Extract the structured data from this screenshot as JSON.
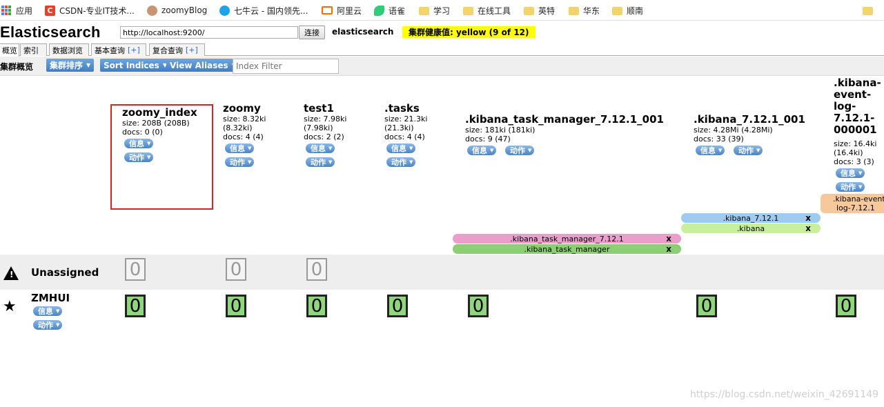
{
  "bookmarks": [
    "应用",
    "CSDN-专业IT技术...",
    "zoomyBlog",
    "七牛云 - 国内领先...",
    "阿里云",
    "语雀",
    "学习",
    "在线工具",
    "英特",
    "华东",
    "顺南"
  ],
  "header": {
    "title": "Elasticsearch",
    "url": "http://localhost:9200/",
    "connect_label": "连接",
    "cluster_name": "elasticsearch",
    "health": "集群健康值: yellow (9 of 12)"
  },
  "tabs": [
    {
      "label": "概览",
      "plus": ""
    },
    {
      "label": "索引",
      "plus": ""
    },
    {
      "label": "数据浏览",
      "plus": ""
    },
    {
      "label": "基本查询",
      "plus": "[+]"
    },
    {
      "label": "复合查询",
      "plus": "[+]"
    }
  ],
  "toolbar": {
    "title": "集群概览",
    "sort_cluster": "集群排序",
    "sort_indices": "Sort Indices",
    "view_aliases": "View Aliases",
    "filter_placeholder": "Index Filter"
  },
  "buttons": {
    "info": "信息",
    "action": "动作"
  },
  "indices": [
    {
      "name": "zoomy_index",
      "stats": [
        "size: 208B (208B)",
        "docs: 0 (0)"
      ]
    },
    {
      "name": "zoomy",
      "stats": [
        "size: 8.32ki",
        "(8.32ki)",
        "docs: 4 (4)"
      ]
    },
    {
      "name": "test1",
      "stats": [
        "size: 7.98ki",
        "(7.98ki)",
        "docs: 2 (2)"
      ]
    },
    {
      "name": ".tasks",
      "stats": [
        "size: 21.3ki",
        "(21.3ki)",
        "docs: 4 (4)"
      ]
    },
    {
      "name": ".kibana_task_manager_7.12.1_001",
      "stats": [
        "size: 181ki (181ki)",
        "docs: 9 (47)"
      ]
    },
    {
      "name": ".kibana_7.12.1_001",
      "stats": [
        "size: 4.28Mi (4.28Mi)",
        "docs: 33 (39)"
      ]
    },
    {
      "name_lines": [
        ".kibana-",
        "event-",
        "log-",
        "7.12.1-",
        "000001"
      ],
      "stats": [
        "size: 16.4ki",
        "(16.4ki)",
        "docs: 3 (3)"
      ]
    }
  ],
  "aliases": {
    "kibana_event": [
      ".kibana-event-",
      "log-7.12.1"
    ],
    "kibana_7121": ".kibana_7.12.1",
    "kibana": ".kibana",
    "task_manager_7121": ".kibana_task_manager_7.12.1",
    "task_manager": ".kibana_task_manager",
    "close": "x"
  },
  "rows": {
    "unassigned": "Unassigned",
    "node": "ZMHUI",
    "shard_value": "0"
  },
  "watermark": "https://blog.csdn.net/weixin_42691149",
  "colors": {
    "health": "#ffff00",
    "highlight": "#e02020",
    "shard": "#8fd67f"
  }
}
